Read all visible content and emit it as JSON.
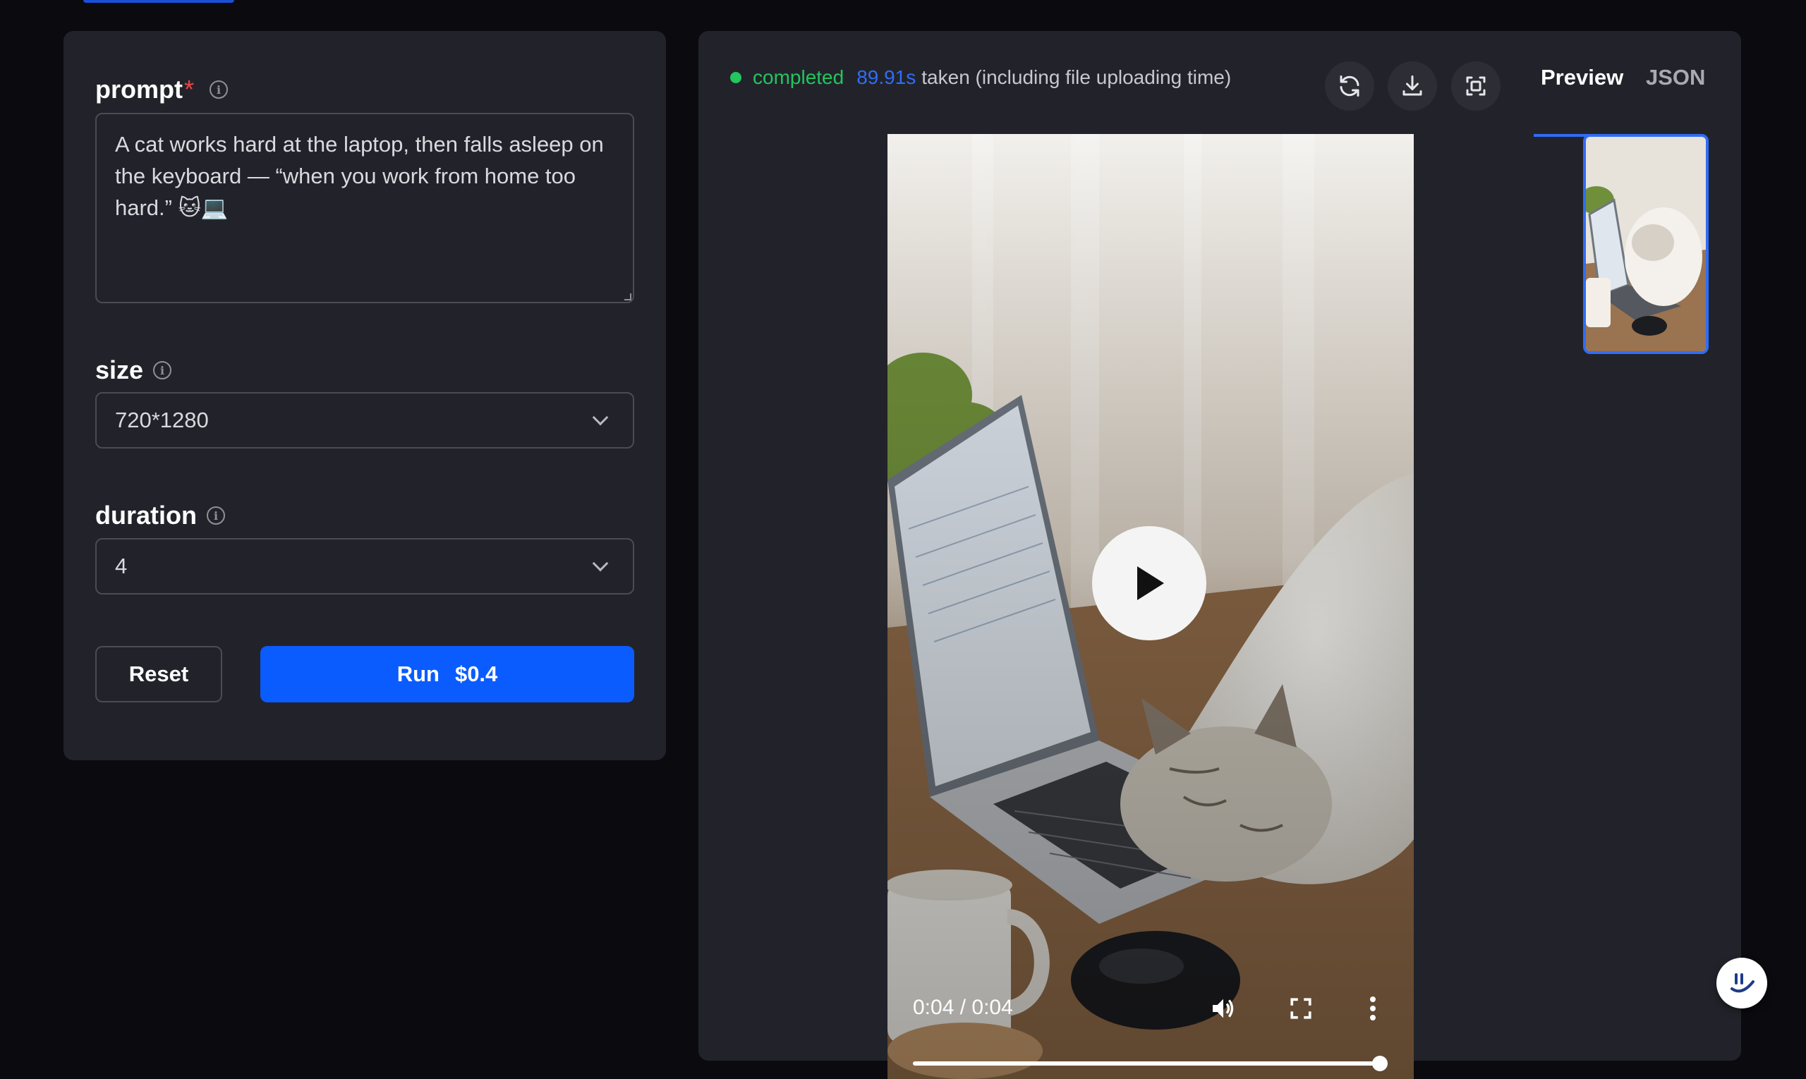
{
  "form": {
    "prompt": {
      "label": "prompt",
      "required_mark": "*",
      "value": "A cat works hard at the laptop, then falls asleep on the keyboard — “when you work from home too hard.” 🐱💻"
    },
    "size": {
      "label": "size",
      "value": "720*1280"
    },
    "duration": {
      "label": "duration",
      "value": "4"
    },
    "reset_label": "Reset",
    "run_label": "Run",
    "run_price": "$0.4"
  },
  "output": {
    "status": "completed",
    "time_value": "89.91s",
    "time_suffix": "taken (including file uploading time)",
    "tabs": [
      {
        "label": "Preview",
        "active": true
      },
      {
        "label": "JSON",
        "active": false
      }
    ],
    "toolbar_icons": [
      "refresh-icon",
      "download-icon",
      "fullscreen-icon"
    ],
    "video": {
      "time_display": "0:04 / 0:04",
      "progress": 1.0,
      "controls": [
        "volume-icon",
        "fullscreen-icon",
        "more-options-icon"
      ]
    }
  },
  "colors": {
    "accent": "#0a5cff",
    "status_green": "#22c55e",
    "panel_bg": "#22232a",
    "page_bg": "#0a0a0f"
  }
}
